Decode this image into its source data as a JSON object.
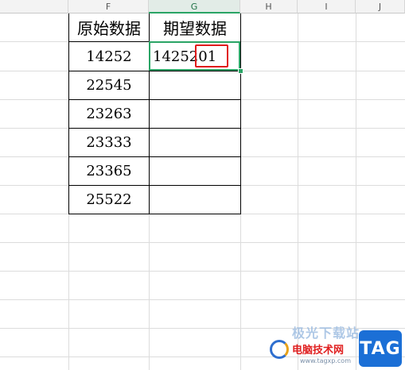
{
  "columns": [
    {
      "letter": "F"
    },
    {
      "letter": "G",
      "active": true
    },
    {
      "letter": "H"
    },
    {
      "letter": "I"
    },
    {
      "letter": "J"
    }
  ],
  "table": {
    "headers": [
      "原始数据",
      "期望数据"
    ],
    "rows": [
      [
        "14252",
        "1425201"
      ],
      [
        "22545",
        ""
      ],
      [
        "23263",
        ""
      ],
      [
        "23333",
        ""
      ],
      [
        "23365",
        ""
      ],
      [
        "25522",
        ""
      ]
    ]
  },
  "active_cell": "G2",
  "highlight_color": "#e01b1b",
  "selection_color": "#2aa465",
  "watermark": {
    "top_text": "极光下载站",
    "main_text": "电脑技术网",
    "url_text": "www.tagxp.com",
    "badge_text": "TAG"
  }
}
